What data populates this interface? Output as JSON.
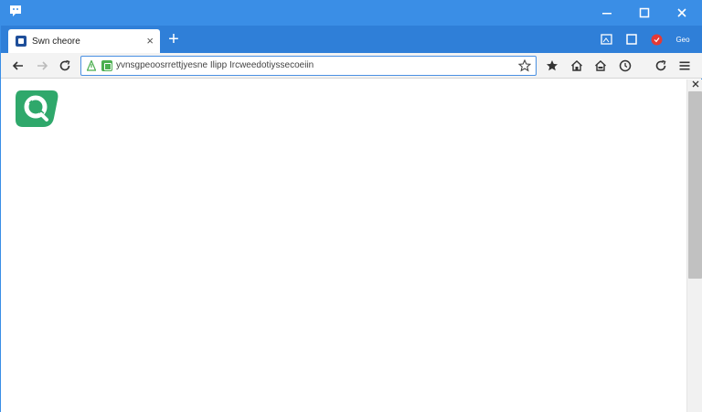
{
  "window": {
    "controls": {
      "minimize_icon": "minimize-icon",
      "maximize_icon": "maximize-icon",
      "close_icon": "close-icon"
    }
  },
  "tab": {
    "title": "Swn cheore",
    "close_label": "×"
  },
  "newtab_label": "+",
  "tray": {
    "text": "Geo"
  },
  "toolbar": {
    "url": "yvnsgpeoosrrettjyesne Ilipp Ircweedotiyssecoeiin"
  },
  "colors": {
    "titlebar": "#3a8ee6",
    "tabstrip": "#2f7fd8",
    "logo": "#2fa86b",
    "secure": "#4caf50"
  }
}
